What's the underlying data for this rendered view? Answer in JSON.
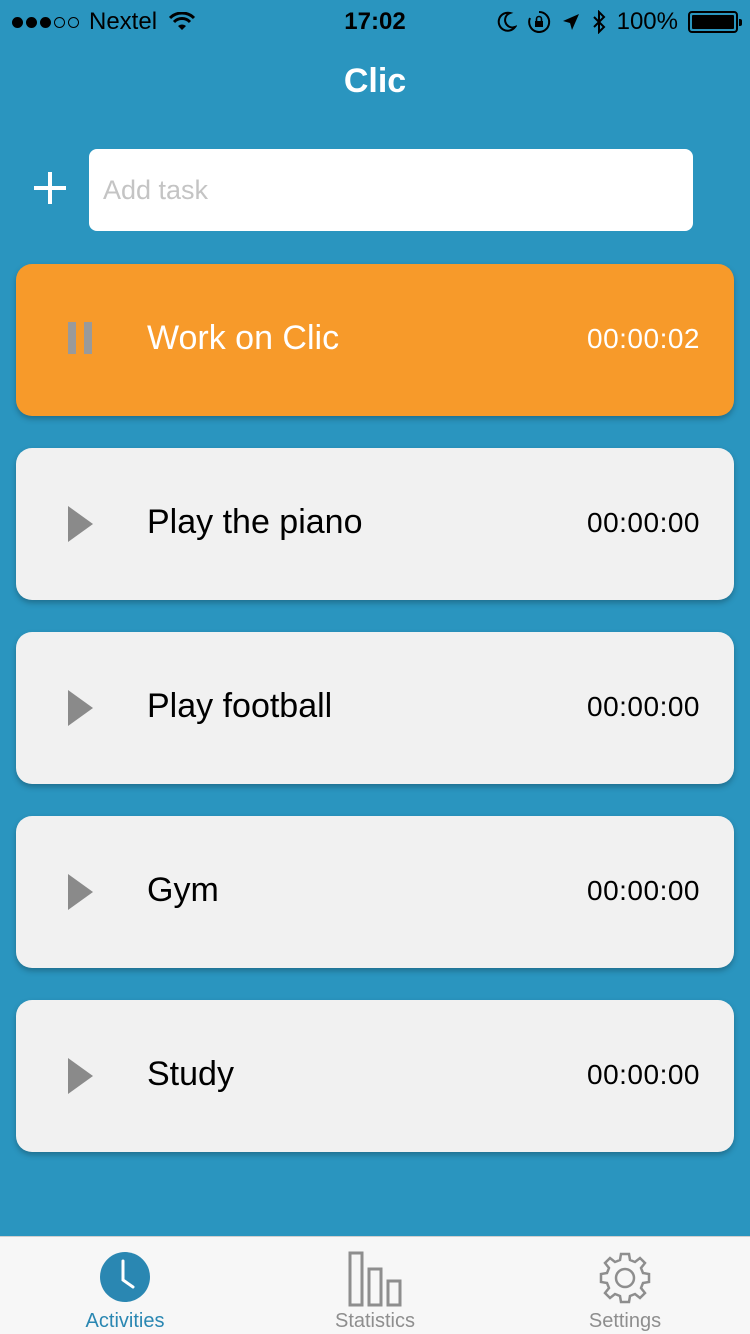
{
  "status_bar": {
    "carrier": "Nextel",
    "time": "17:02",
    "battery": "100%",
    "signal_bars_filled": 3,
    "signal_bars_total": 5
  },
  "header": {
    "title": "Clic"
  },
  "add_task": {
    "placeholder": "Add task"
  },
  "tasks": [
    {
      "name": "Work on Clic",
      "time": "00:00:02",
      "state": "running"
    },
    {
      "name": "Play the piano",
      "time": "00:00:00",
      "state": "stopped"
    },
    {
      "name": "Play football",
      "time": "00:00:00",
      "state": "stopped"
    },
    {
      "name": "Gym",
      "time": "00:00:00",
      "state": "stopped"
    },
    {
      "name": "Study",
      "time": "00:00:00",
      "state": "stopped"
    }
  ],
  "tab_bar": {
    "tabs": [
      {
        "label": "Activities",
        "icon": "clock-icon",
        "selected": true
      },
      {
        "label": "Statistics",
        "icon": "bar-chart-icon",
        "selected": false
      },
      {
        "label": "Settings",
        "icon": "gear-icon",
        "selected": false
      }
    ]
  },
  "colors": {
    "background": "#2a95bf",
    "active_card": "#f79a2a",
    "card": "#f1f1f1",
    "tab_selected": "#2a87b2"
  }
}
